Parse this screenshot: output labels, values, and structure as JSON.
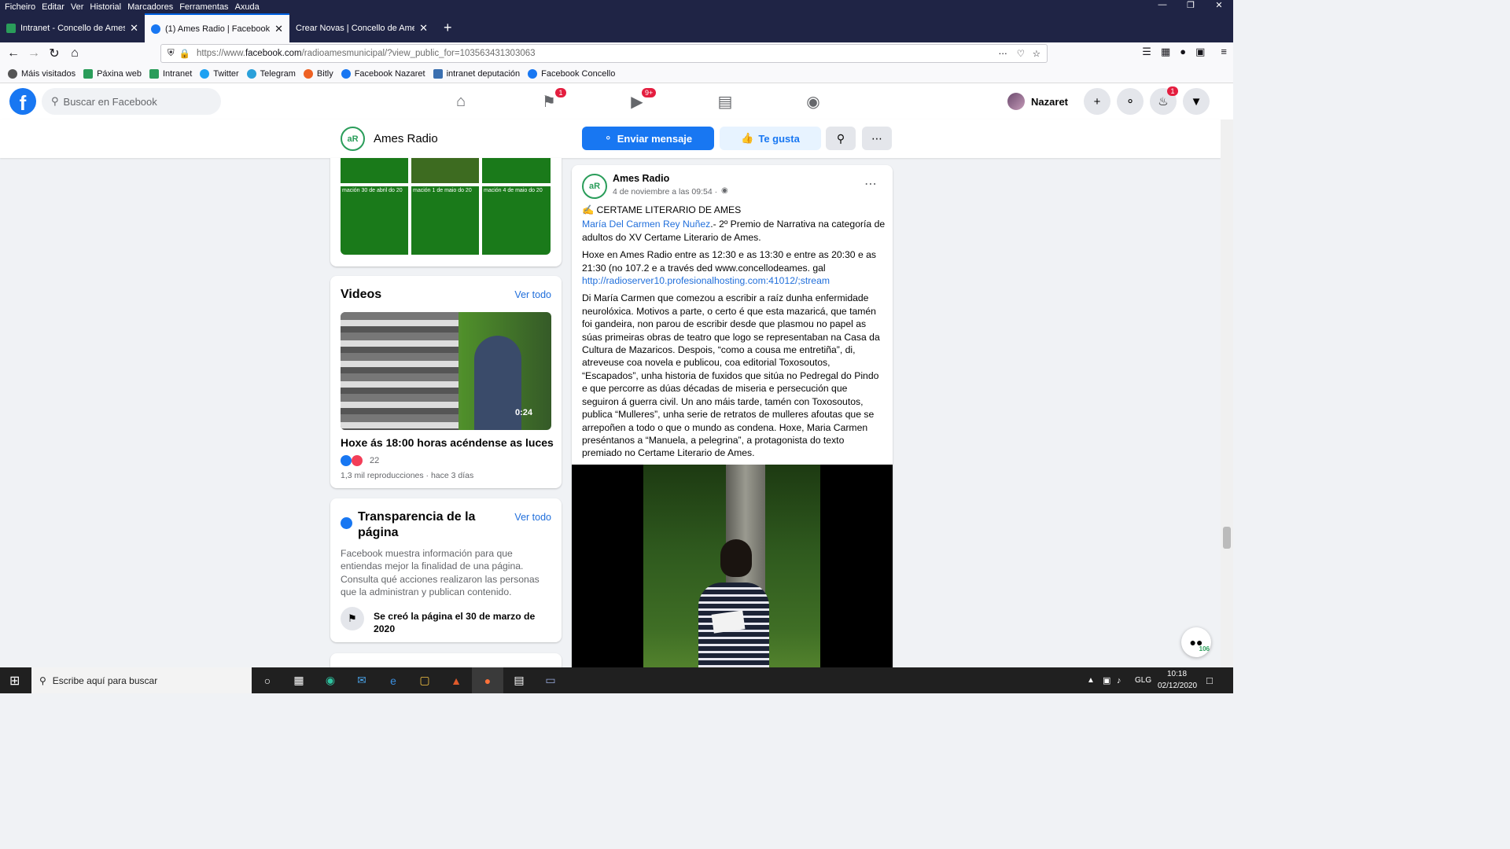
{
  "menu": [
    "Ficheiro",
    "Editar",
    "Ver",
    "Historial",
    "Marcadores",
    "Ferramentas",
    "Axuda"
  ],
  "tabs": [
    {
      "title": "Intranet - Concello de Ames | A",
      "active": false
    },
    {
      "title": "(1) Ames Radio | Facebook",
      "active": true
    },
    {
      "title": "Crear Novas | Concello de Ames",
      "active": false
    }
  ],
  "url": {
    "prefix": "https://www.",
    "domain": "facebook.com",
    "rest": "/radioamesmunicipal/?view_public_for=103563431303063"
  },
  "bookmarks": [
    "Máis visitados",
    "Páxina web",
    "Intranet",
    "Twitter",
    "Telegram",
    "Bitly",
    "Facebook Nazaret",
    "intranet deputación",
    "Facebook Concello"
  ],
  "fb": {
    "search_placeholder": "Buscar en Facebook",
    "user": "Nazaret",
    "badge_flag": "1",
    "badge_video": "9+",
    "badge_bell": "1"
  },
  "page": {
    "name": "Ames Radio",
    "send": "Enviar mensaje",
    "like": "Te gusta"
  },
  "photos": {
    "cells": [
      "mación 30 de abril do 20",
      "mación 1 de maio do 20",
      "mación 4 de maio do 20"
    ]
  },
  "videos": {
    "title": "Videos",
    "see_all": "Ver todo",
    "duration": "0:24",
    "caption": "Hoxe ás 18:00 horas acéndense as luces ...",
    "reactions": "22",
    "meta": "1,3 mil reproducciones · hace 3 días"
  },
  "transparency": {
    "title": "Transparencia de la página",
    "see_all": "Ver todo",
    "desc": "Facebook muestra información para que entiendas mejor la finalidad de una página. Consulta qué acciones realizaron las personas que la administran y publican contenido.",
    "created": "Se creó la página el 30 de marzo de 2020"
  },
  "post": {
    "author": "Ames Radio",
    "time": "4 de noviembre a las 09:54 ·",
    "headline": "✍️ CERTAME LITERARIO DE AMES",
    "mention": "María Del Carmen Rey Nuñez",
    "line1": ".- 2º Premio de Narrativa na categoría de adultos do XV Certame Literario de Ames.",
    "para2": "Hoxe en Ames Radio entre as 12:30 e as 13:30 e entre as 20:30 e as 21:30 (no 107.2 e a través ded www.concellodeames. gal",
    "stream": "http://radioserver10.profesionalhosting.com:41012/;stream",
    "para3": "Di María Carmen que comezou a escribir a raíz dunha enfermidade neurolóxica. Motivos a parte, o certo é que esta mazaricá, que tamén foi gandeira, non parou de escribir desde que plasmou no papel as súas primeiras obras de teatro que logo se representaban na Casa da Cultura de Mazaricos. Despois, “como a cousa me entretiña”, di, atreveuse coa novela e publicou, coa editorial Toxosoutos, “Escapados”, unha historia de fuxidos que sitúa no Pedregal do Pindo e que percorre as dúas décadas de miseria e persecución que seguiron á guerra civil. Un ano máis tarde, tamén con Toxosoutos, publica “Mulleres”, unha serie de retratos de mulleres afoutas que se arrepoñen a todo o que o mundo as condena. Hoxe, Maria Carmen preséntanos a “Manuela, a pelegrina”, a protagonista do texto premiado no Certame Literario de Ames."
  },
  "chat_count": "106",
  "taskbar": {
    "search": "Escribe aquí para buscar",
    "lang": "GLG",
    "time": "10:18",
    "date": "02/12/2020"
  }
}
